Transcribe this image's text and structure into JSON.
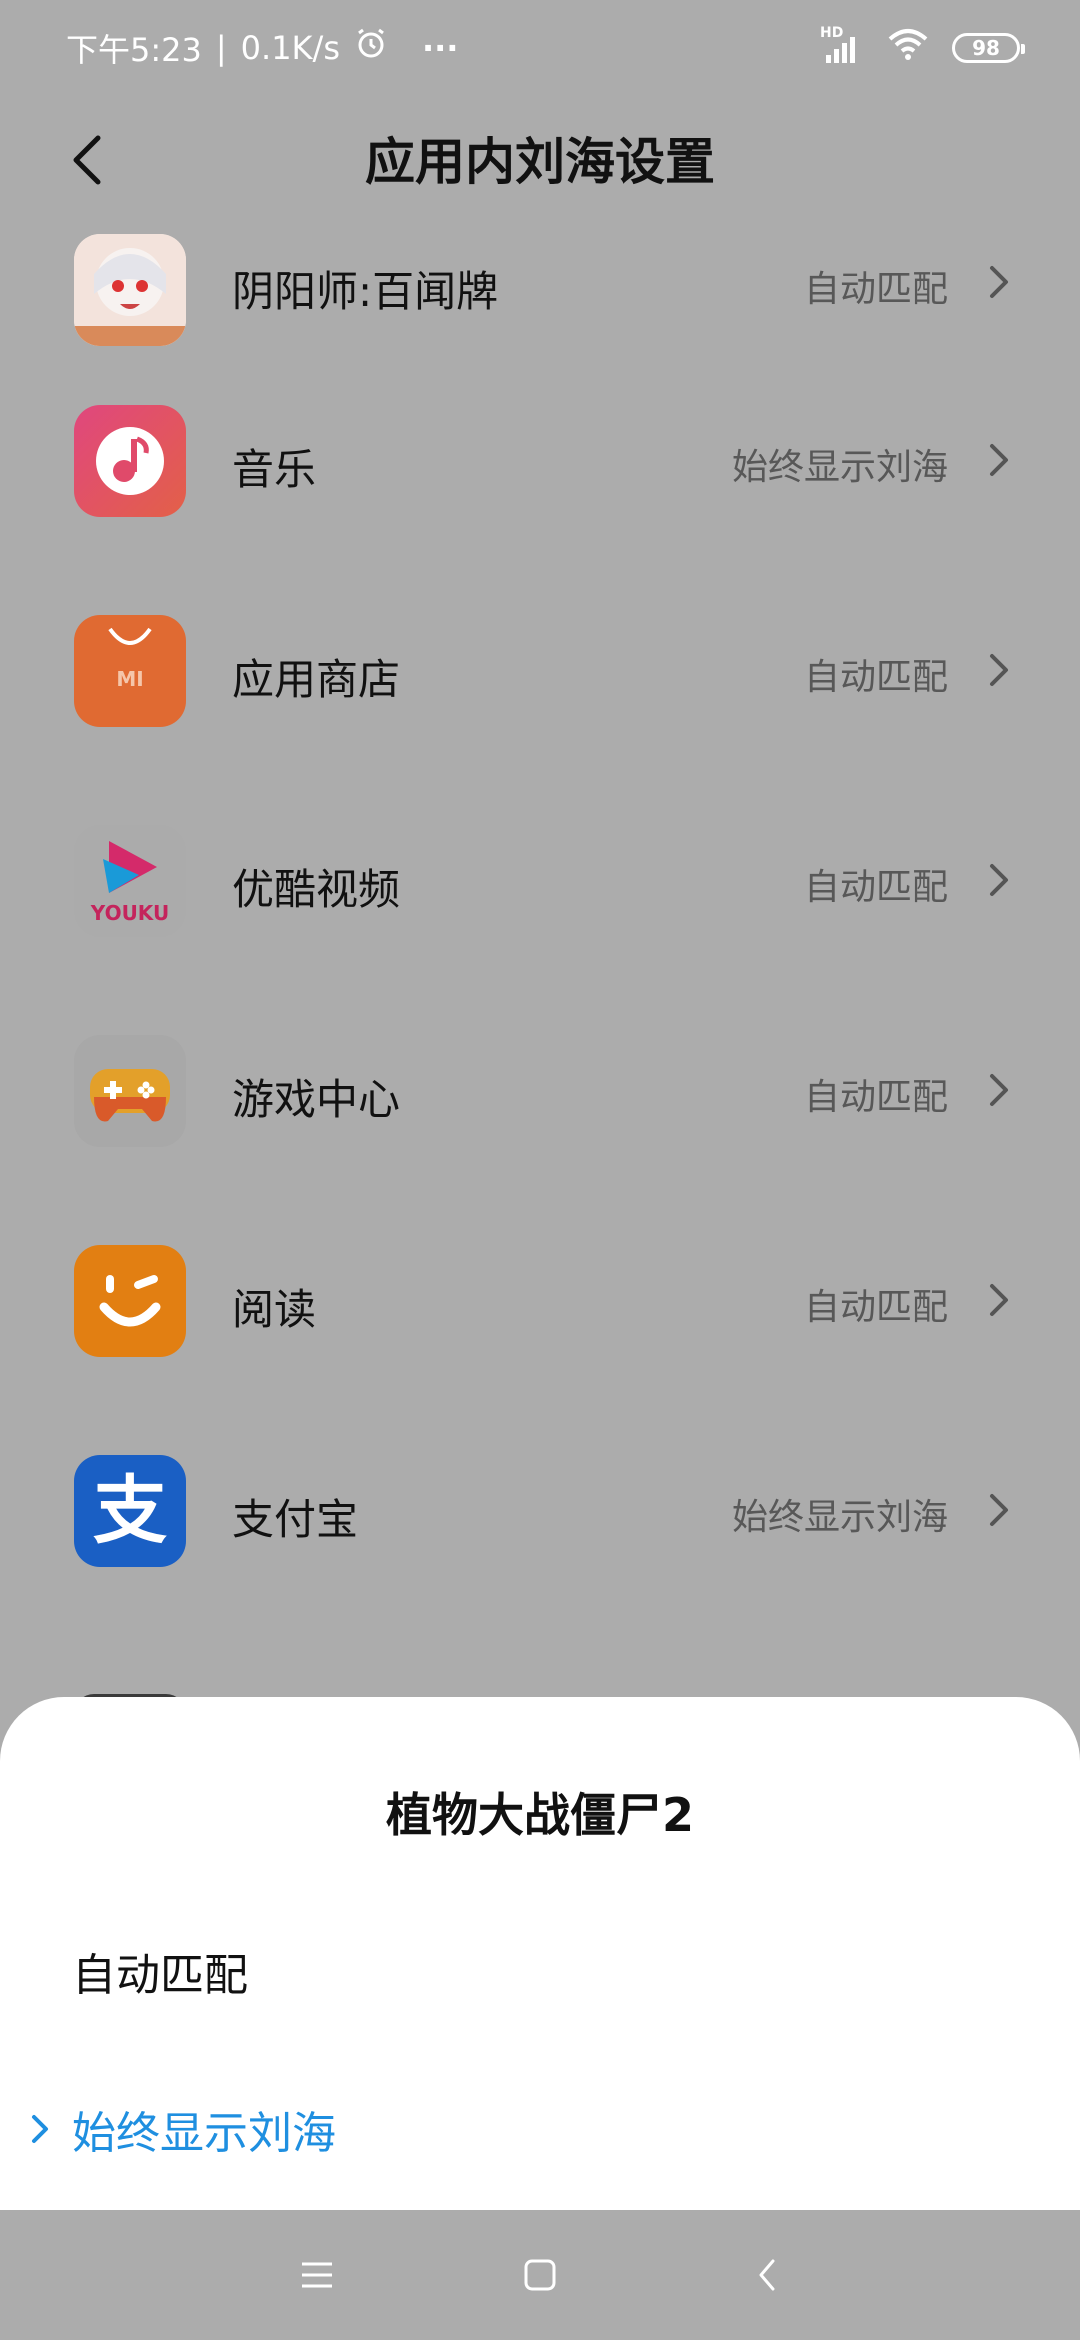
{
  "status_bar": {
    "time": "下午5:23",
    "speed": "0.1K/s",
    "separator": "|",
    "more": "···",
    "network": "HD",
    "battery": "98"
  },
  "header": {
    "title": "应用内刘海设置"
  },
  "apps": [
    {
      "name": "阴阳师:百闻牌",
      "value": "自动匹配",
      "icon": "onmyoji-icon"
    },
    {
      "name": "音乐",
      "value": "始终显示刘海",
      "icon": "music-icon"
    },
    {
      "name": "应用商店",
      "value": "自动匹配",
      "icon": "app-store-icon",
      "icon_text": "MI"
    },
    {
      "name": "优酷视频",
      "value": "自动匹配",
      "icon": "youku-icon",
      "icon_text": "YOUKU"
    },
    {
      "name": "游戏中心",
      "value": "自动匹配",
      "icon": "game-center-icon"
    },
    {
      "name": "阅读",
      "value": "自动匹配",
      "icon": "reader-icon"
    },
    {
      "name": "支付宝",
      "value": "始终显示刘海",
      "icon": "alipay-icon",
      "icon_text": "支"
    }
  ],
  "sheet": {
    "title": "植物大战僵尸2",
    "options": [
      {
        "label": "自动匹配",
        "selected": false
      },
      {
        "label": "始终显示刘海",
        "selected": true
      }
    ]
  },
  "colors": {
    "accent": "#1f8fe0",
    "dim_background": "#acacac"
  }
}
